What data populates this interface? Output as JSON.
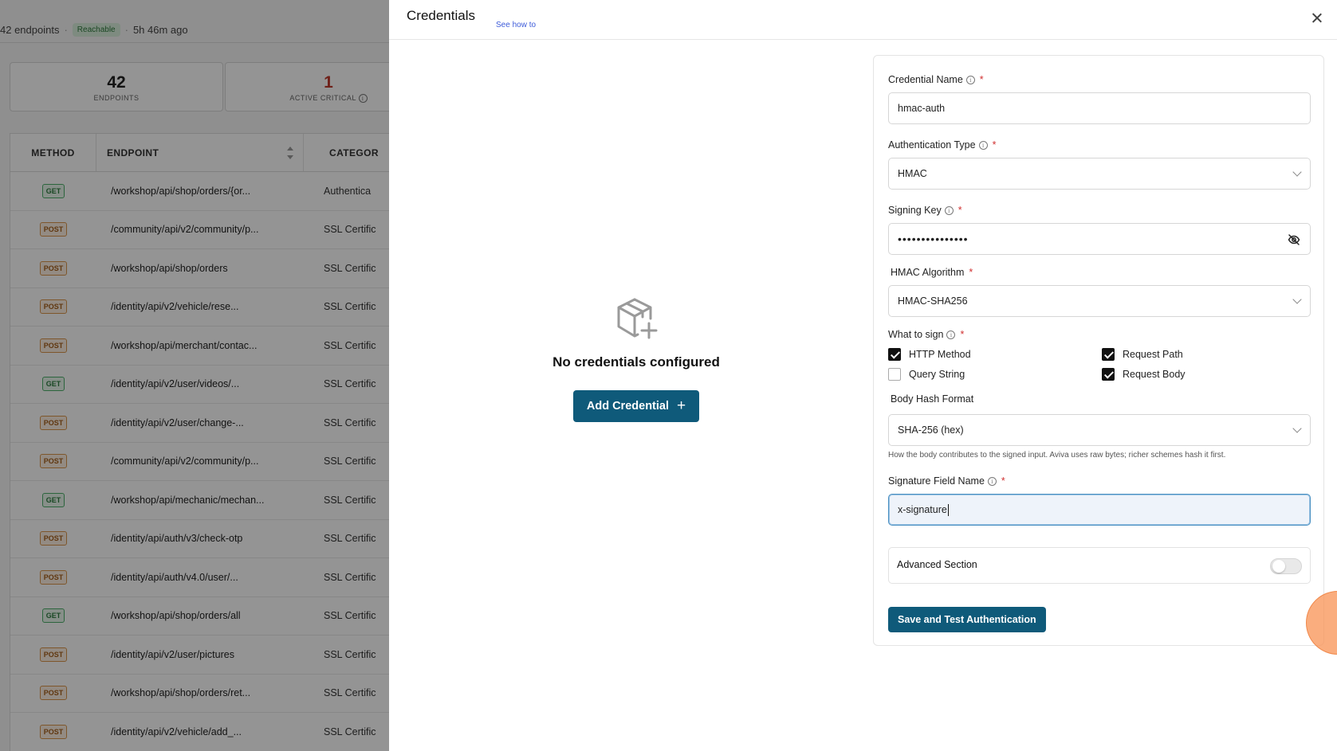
{
  "background": {
    "summary": {
      "endpoints_text": "42 endpoints",
      "status": "Reachable",
      "updated": "5h 46m ago"
    },
    "stats": [
      {
        "value": "42",
        "label": "ENDPOINTS"
      },
      {
        "value": "1",
        "label": "ACTIVE CRITICAL"
      }
    ],
    "table": {
      "headers": {
        "method": "METHOD",
        "endpoint": "ENDPOINT",
        "category": "CATEGOR"
      },
      "rows": [
        {
          "method": "GET",
          "endpoint": "/workshop/api/shop/orders/{or...",
          "category": "Authentica"
        },
        {
          "method": "POST",
          "endpoint": "/community/api/v2/community/p...",
          "category": "SSL Certific"
        },
        {
          "method": "POST",
          "endpoint": "/workshop/api/shop/orders",
          "category": "SSL Certific"
        },
        {
          "method": "POST",
          "endpoint": "/identity/api/v2/vehicle/rese...",
          "category": "SSL Certific"
        },
        {
          "method": "POST",
          "endpoint": "/workshop/api/merchant/contac...",
          "category": "SSL Certific"
        },
        {
          "method": "GET",
          "endpoint": "/identity/api/v2/user/videos/...",
          "category": "SSL Certific"
        },
        {
          "method": "POST",
          "endpoint": "/identity/api/v2/user/change-...",
          "category": "SSL Certific"
        },
        {
          "method": "POST",
          "endpoint": "/community/api/v2/community/p...",
          "category": "SSL Certific"
        },
        {
          "method": "GET",
          "endpoint": "/workshop/api/mechanic/mechan...",
          "category": "SSL Certific"
        },
        {
          "method": "POST",
          "endpoint": "/identity/api/auth/v3/check-otp",
          "category": "SSL Certific"
        },
        {
          "method": "POST",
          "endpoint": "/identity/api/auth/v4.0/user/...",
          "category": "SSL Certific"
        },
        {
          "method": "GET",
          "endpoint": "/workshop/api/shop/orders/all",
          "category": "SSL Certific"
        },
        {
          "method": "POST",
          "endpoint": "/identity/api/v2/user/pictures",
          "category": "SSL Certific"
        },
        {
          "method": "POST",
          "endpoint": "/workshop/api/shop/orders/ret...",
          "category": "SSL Certific"
        },
        {
          "method": "POST",
          "endpoint": "/identity/api/v2/vehicle/add_...",
          "category": "SSL Certific"
        }
      ]
    }
  },
  "drawer": {
    "title": "Credentials",
    "see_how": "See how to",
    "empty": {
      "text": "No credentials configured",
      "add_button": "Add Credential",
      "add_icon": "+"
    },
    "form": {
      "credential_name": {
        "label": "Credential Name",
        "value": "hmac-auth"
      },
      "auth_type": {
        "label": "Authentication Type",
        "value": "HMAC"
      },
      "signing_key": {
        "label": "Signing Key",
        "value": "•••••••••••••••"
      },
      "algorithm": {
        "label": "HMAC Algorithm",
        "value": "HMAC-SHA256"
      },
      "what_to_sign": {
        "label": "What to sign",
        "options": [
          {
            "label": "HTTP Method",
            "checked": true
          },
          {
            "label": "Request Path",
            "checked": true
          },
          {
            "label": "Query String",
            "checked": false
          },
          {
            "label": "Request Body",
            "checked": true
          }
        ]
      },
      "body_hash": {
        "label": "Body Hash Format",
        "value": "SHA-256 (hex)",
        "hint": "How the body contributes to the signed input. Aviva uses raw bytes; richer schemes hash it first."
      },
      "signature_field": {
        "label": "Signature Field Name",
        "value": "x-signature"
      },
      "advanced": {
        "label": "Advanced Section",
        "enabled": false
      },
      "save_button": "Save and Test Authentication"
    }
  },
  "colors": {
    "primary": "#0f5a7a",
    "required": "#d03030",
    "click_indicator": "#f8965a"
  }
}
